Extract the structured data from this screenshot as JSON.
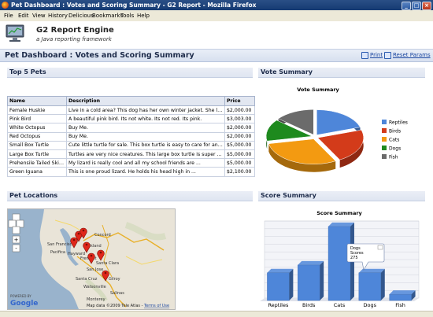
{
  "window": {
    "title": "Pet Dashboard : Votes and Scoring Summary - G2 Report - Mozilla Firefox"
  },
  "menu": [
    "File",
    "Edit",
    "View",
    "History",
    "Delicious",
    "Bookmarks",
    "Tools",
    "Help"
  ],
  "app": {
    "name": "G2 Report Engine",
    "subtitle": "a Java reporting framework"
  },
  "page": {
    "title": "Pet Dashboard : Votes and Scoring Summary",
    "print_label": "Print",
    "reset_label": "Reset Params"
  },
  "sections": {
    "top5": "Top 5 Pets",
    "votes": "Vote Summary",
    "locations": "Pet Locations",
    "score": "Score Summary"
  },
  "table": {
    "headers": [
      "Name",
      "Description",
      "Price"
    ],
    "rows": [
      [
        "Female Huskie",
        "Live in a cold area? This dog has her own winter jacket. She loves ...",
        "$2,000.00"
      ],
      [
        "Pink Bird",
        "A beautiful pink bird. Its not white. Its not red. Its pink.",
        "$3,003.00"
      ],
      [
        "White Octopus",
        "Buy Me.",
        "$2,000.00"
      ],
      [
        "Red Octopus",
        "Buy Me.",
        "$2,000.00"
      ],
      [
        "Small Box Turtle",
        "Cute little turtle for sale. This box turtle is easy to care for and ...",
        "$5,000.00"
      ],
      [
        "Large Box Turtle",
        "Turtles are very nice creatures. This large box turtle is super fast...",
        "$5,000.00"
      ],
      [
        "Prehensile Tailed Skink",
        "My lizard is really cool and all my school friends are ...",
        "$5,000.00"
      ],
      [
        "Green Iguana",
        "This is one proud lizard. He holds his head high in ...",
        "$2,100.00"
      ]
    ]
  },
  "map": {
    "places": [
      "Concord",
      "San Francisco",
      "Oakland",
      "Hayward",
      "Fremont",
      "San Jose",
      "Santa Cruz",
      "Gilroy",
      "Watsonville",
      "Salinas",
      "Monterey",
      "Santa Clara",
      "Pacifica"
    ],
    "attribution": "Map data ©2009 Tele Atlas -",
    "terms": "Terms of Use",
    "powered_by": "POWERED BY",
    "logo_text": "Google",
    "zoom_in": "+",
    "zoom_out": "-"
  },
  "chart_data": [
    {
      "type": "pie",
      "title": "Vote Summary",
      "categories": [
        "Reptiles",
        "Birds",
        "Cats",
        "Dogs",
        "Fish"
      ],
      "values": [
        20,
        22,
        30,
        14,
        14
      ],
      "colors": [
        "#4e86d9",
        "#d33b1a",
        "#f39a11",
        "#1e8a1e",
        "#6b6b6b"
      ],
      "legend": "right"
    },
    {
      "type": "bar",
      "title": "Score Summary",
      "categories": [
        "Reptiles",
        "Birds",
        "Cats",
        "Dogs",
        "Fish"
      ],
      "values": [
        90,
        115,
        240,
        90,
        20
      ],
      "ylim": [
        0,
        250
      ],
      "grid": true,
      "color": "#4e86d9",
      "tooltip": {
        "series": "Dogs",
        "label": "Scores",
        "value": "275"
      }
    }
  ]
}
